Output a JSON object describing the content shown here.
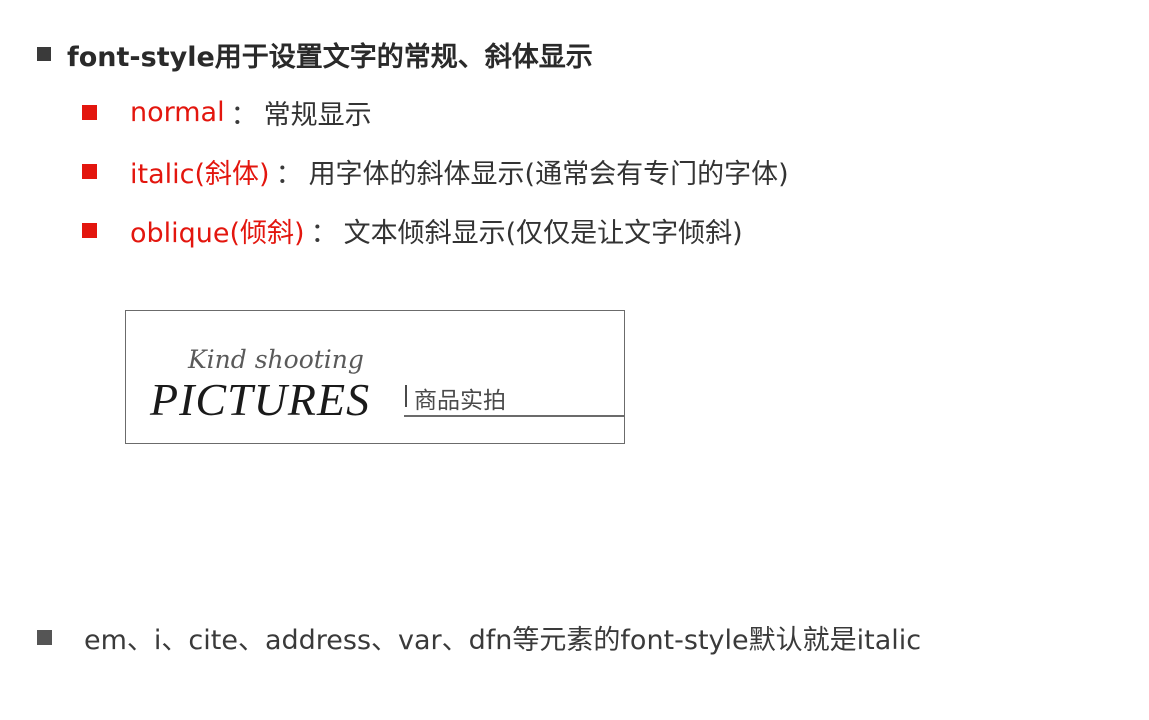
{
  "heading": {
    "text": "font-style用于设置文字的常规、斜体显示",
    "bullet_icon": "square-bullet-icon",
    "bullet_color": "#3a3a3a"
  },
  "items": [
    {
      "term": "normal",
      "colon": "：",
      "description": "常规显示"
    },
    {
      "term": "italic(斜体)",
      "colon": "：",
      "description": "用字体的斜体显示(通常会有专门的字体)"
    },
    {
      "term": "oblique(倾斜)",
      "colon": "：",
      "description": "文本倾斜显示(仅仅是让文字倾斜)"
    }
  ],
  "item_bullet_color": "#e3160e",
  "term_color": "#e3160e",
  "example": {
    "kind_shooting": "Kind shooting",
    "pictures": "PICTURES",
    "product_label": "商品实拍"
  },
  "note": {
    "text": "em、i、cite、address、var、dfn等元素的font-style默认就是italic",
    "bullet_color": "#555555"
  }
}
